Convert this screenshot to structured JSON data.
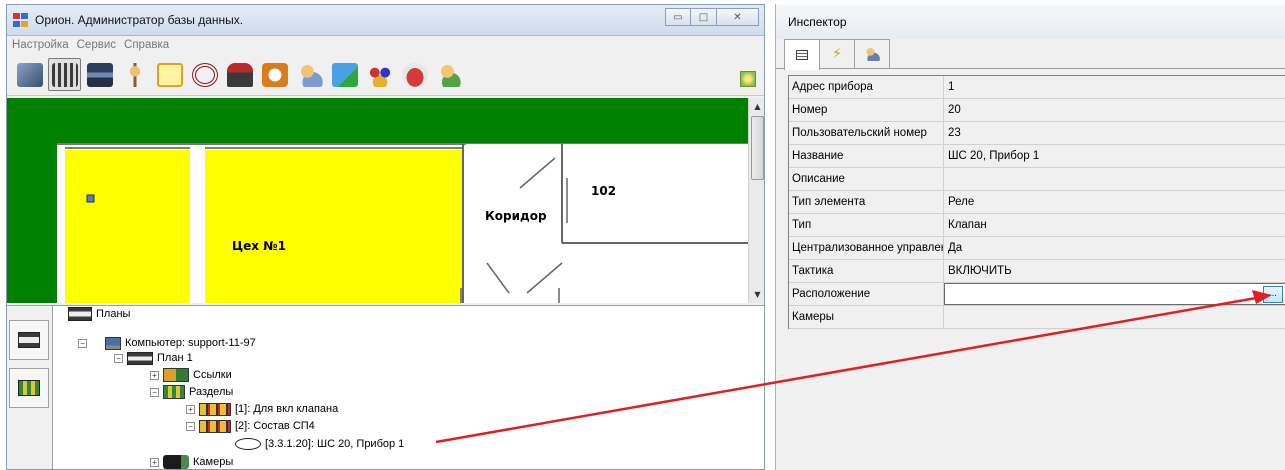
{
  "main_window": {
    "title": "Орион. Администратор базы данных.",
    "controls": {
      "minimize": "▭",
      "maximize": "□",
      "close": "✕"
    },
    "menu": [
      "Настройка",
      "Сервис",
      "Справка"
    ],
    "toolbar_icons": [
      "plans-icon",
      "sections-icon",
      "devices-icon",
      "palm-icon",
      "document-icon",
      "wheel-icon",
      "train-icon",
      "clock-icon",
      "users-icon",
      "add-card-icon",
      "groups-icon",
      "car-icon",
      "key-user-icon"
    ]
  },
  "plan": {
    "rooms": {
      "workshop": "Цех №1",
      "corridor": "Коридор",
      "room_number": "102"
    }
  },
  "tree": {
    "root": "Планы",
    "computer": "Компьютер: support-11-97",
    "plan": "План 1",
    "links": "Ссылки",
    "sections": "Разделы",
    "section1": "[1]: Для вкл клапана",
    "section2": "[2]: Состав СП4",
    "zone": "[3.3.1.20]: ШС 20, Прибор 1",
    "cameras": "Камеры"
  },
  "inspector": {
    "title": "Инспектор",
    "tabs": [
      "properties-icon",
      "events-icon",
      "users-icon"
    ],
    "properties": [
      {
        "name": "Адрес прибора",
        "value": "1"
      },
      {
        "name": "Номер",
        "value": "20"
      },
      {
        "name": "Пользовательский номер",
        "value": "23"
      },
      {
        "name": "Название",
        "value": "ШС 20, Прибор 1"
      },
      {
        "name": "Описание",
        "value": ""
      },
      {
        "name": "Тип элемента",
        "value": "Реле"
      },
      {
        "name": "Тип",
        "value": "Клапан"
      },
      {
        "name": "Централизованное управлен",
        "value": "Да"
      },
      {
        "name": "Тактика",
        "value": "ВКЛЮЧИТЬ"
      },
      {
        "name": "Расположение",
        "value": ""
      },
      {
        "name": "Камеры",
        "value": ""
      }
    ],
    "ellipsis": "..."
  },
  "accent_colors": {
    "plan_background": "#008000",
    "room_fill": "#ffff00",
    "annotation_arrow": "#e02020"
  }
}
